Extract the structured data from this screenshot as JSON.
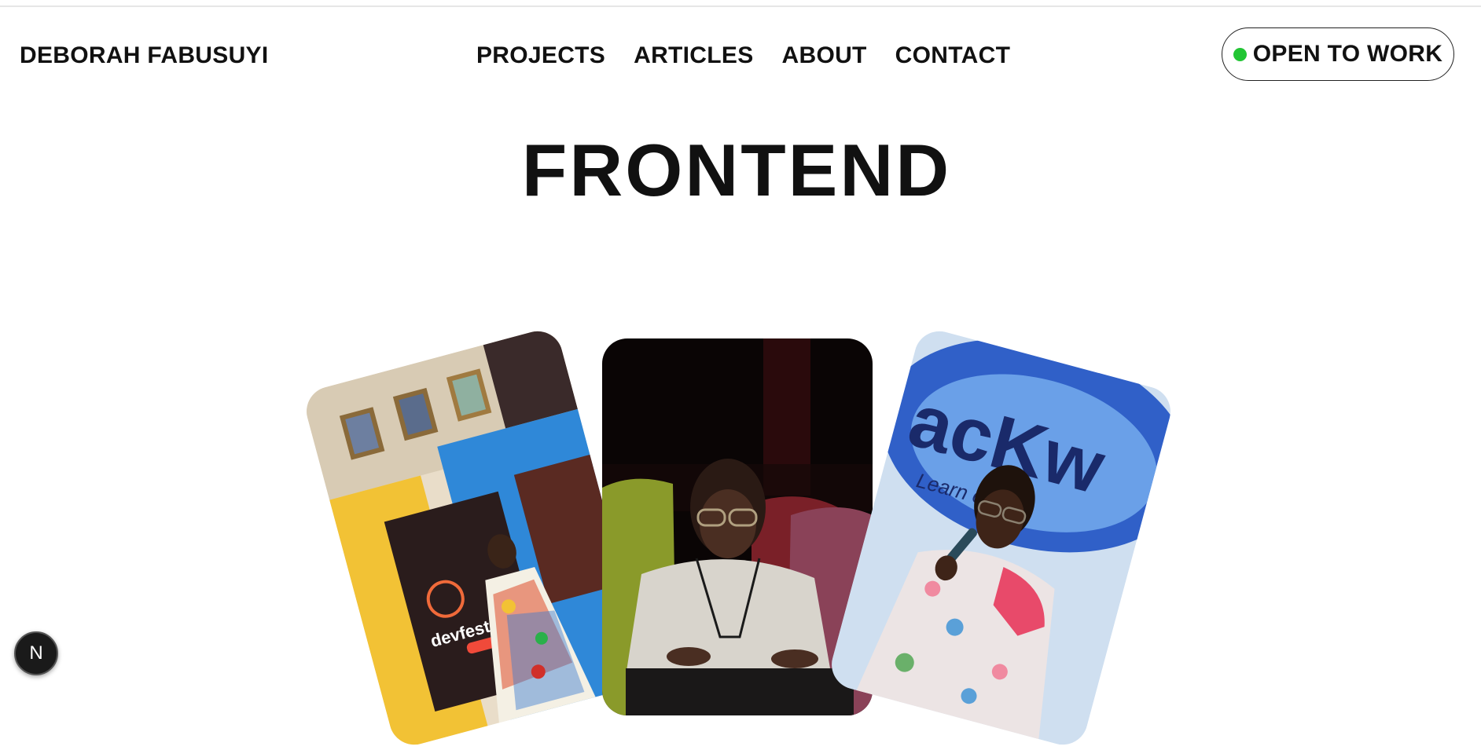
{
  "header": {
    "brand": "DEBORAH FABUSUYI",
    "nav": [
      {
        "label": "PROJECTS"
      },
      {
        "label": "ARTICLES"
      },
      {
        "label": "ABOUT"
      },
      {
        "label": "CONTACT"
      }
    ],
    "status": {
      "label": "OPEN TO WORK",
      "dot_color": "#22c534"
    }
  },
  "hero": {
    "title": "FRONTEND"
  },
  "gallery": {
    "cards": [
      {
        "name": "photo-devfest-speaker",
        "sign_text": "devfest"
      },
      {
        "name": "photo-seated-portrait"
      },
      {
        "name": "photo-hackathon-speaker",
        "sign_text": "acKw",
        "sign_subtext": "Learn  etwork"
      }
    ]
  },
  "dev_badge": {
    "label": "N"
  }
}
